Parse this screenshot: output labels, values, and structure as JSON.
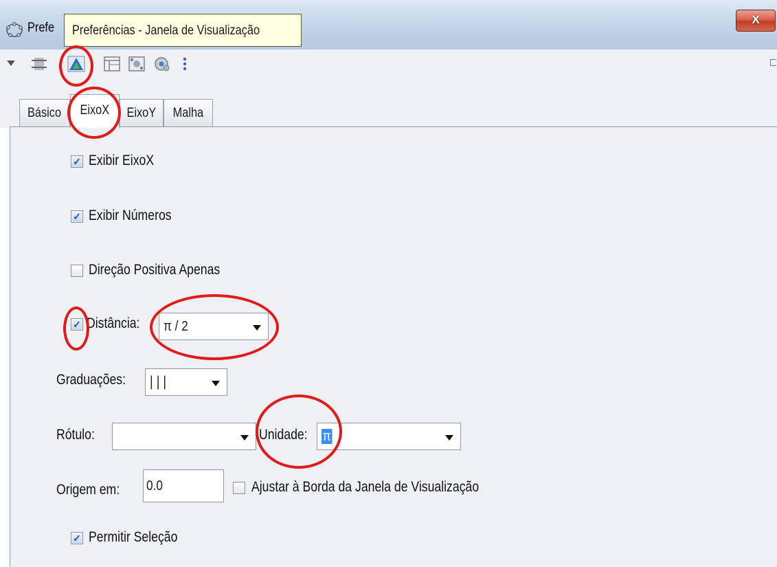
{
  "window": {
    "title": "Prefe",
    "close_label": "X"
  },
  "tooltip": {
    "text": "Preferências - Janela de Visualização"
  },
  "toolbar": {
    "icons": [
      "menu-arrow-icon",
      "axes-icon",
      "graphics-view-icon",
      "layout-icon",
      "algebra-icon",
      "settings-icon",
      "more-icon"
    ]
  },
  "tabs": [
    {
      "label": "Básico",
      "active": false
    },
    {
      "label": "EixoX",
      "active": true
    },
    {
      "label": "EixoY",
      "active": false
    },
    {
      "label": "Malha",
      "active": false
    }
  ],
  "form": {
    "show_axis": {
      "label": "Exibir EixoX",
      "checked": true
    },
    "show_numbers": {
      "label": "Exibir Números",
      "checked": true
    },
    "positive_only": {
      "label": "Direção Positiva Apenas",
      "checked": false
    },
    "distance": {
      "label": "Distância:",
      "checked": true,
      "value": "π / 2"
    },
    "ticks": {
      "label": "Graduações:",
      "value": "|   |   |"
    },
    "label_field": {
      "label": "Rótulo:",
      "value": ""
    },
    "unit": {
      "label": "Unidade:",
      "value": "π"
    },
    "origin": {
      "label": "Origem em:",
      "value": "0.0"
    },
    "snap_to_edge": {
      "label": "Ajustar à Borda da Janela de Visualização",
      "checked": false
    },
    "allow_selection": {
      "label": "Permitir Seleção",
      "checked": true
    }
  },
  "colors": {
    "annotation": "#e11a1a",
    "selection": "#3b8ff0",
    "tooltip_bg": "#ffffe1"
  }
}
